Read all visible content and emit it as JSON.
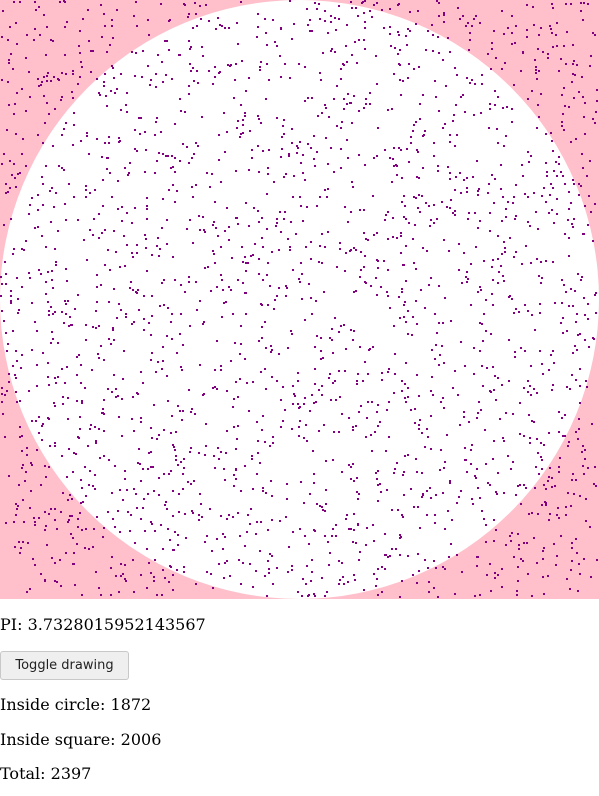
{
  "simulation": {
    "square_color": "#ffc0cb",
    "circle_color": "#ffffff",
    "point_color": "#800080",
    "points_drawn": 2397
  },
  "readouts": {
    "pi_label": "PI:",
    "pi_value": "3.7328015952143567",
    "inside_circle_label": "Inside circle:",
    "inside_circle_value": "1872",
    "inside_square_label": "Inside square:",
    "inside_square_value": "2006",
    "total_label": "Total:",
    "total_value": "2397"
  },
  "controls": {
    "toggle_label": "Toggle drawing"
  }
}
